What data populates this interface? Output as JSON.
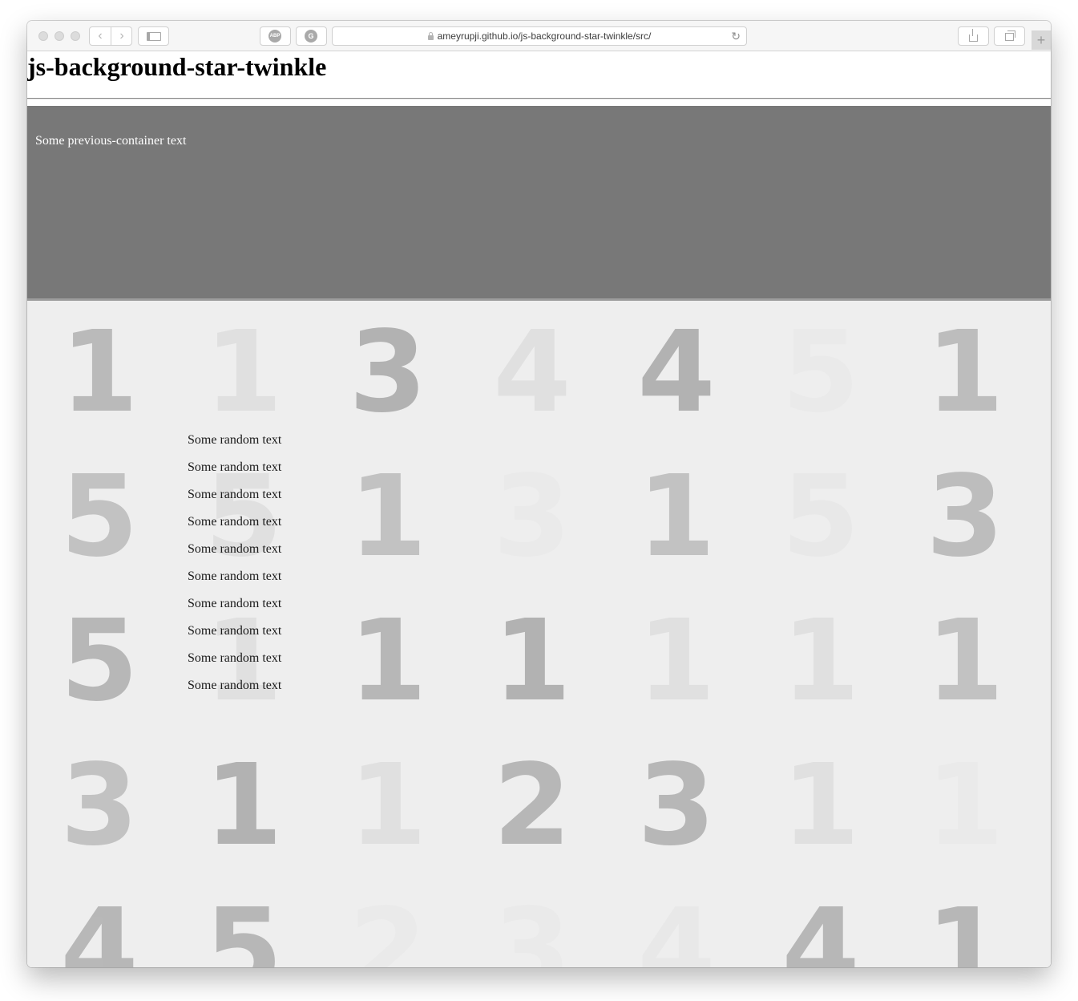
{
  "browser": {
    "url": "ameyrupji.github.io/js-background-star-twinkle/src/",
    "extension_1_label": "ABP",
    "extension_2_label": "G"
  },
  "page": {
    "title": "js-background-star-twinkle",
    "previous_container_text": "Some previous-container text",
    "random_text_lines": [
      "Some random text",
      "Some random text",
      "Some random text",
      "Some random text",
      "Some random text",
      "Some random text",
      "Some random text",
      "Some random text",
      "Some random text",
      "Some random text"
    ]
  },
  "twinkle_grid": {
    "rows": [
      {
        "digits": [
          "1",
          "1",
          "3",
          "4",
          "4",
          "5",
          "1"
        ],
        "opacity": [
          0.48,
          0.12,
          0.55,
          0.12,
          0.55,
          0.03,
          0.45
        ]
      },
      {
        "digits": [
          "5",
          "5",
          "1",
          "3",
          "1",
          "5",
          "3"
        ],
        "opacity": [
          0.4,
          0.12,
          0.4,
          0.03,
          0.4,
          0.05,
          0.45
        ]
      },
      {
        "digits": [
          "5",
          "1",
          "1",
          "1",
          "1",
          "1",
          "1"
        ],
        "opacity": [
          0.5,
          0.12,
          0.5,
          0.55,
          0.12,
          0.12,
          0.4
        ]
      },
      {
        "digits": [
          "3",
          "1",
          "1",
          "2",
          "3",
          "1",
          "1"
        ],
        "opacity": [
          0.4,
          0.55,
          0.12,
          0.5,
          0.5,
          0.12,
          0.03
        ]
      },
      {
        "digits": [
          "4",
          "5",
          "2",
          "3",
          "4",
          "4",
          "1"
        ],
        "opacity": [
          0.5,
          0.5,
          0.03,
          0.03,
          0.05,
          0.5,
          0.5
        ]
      }
    ]
  }
}
